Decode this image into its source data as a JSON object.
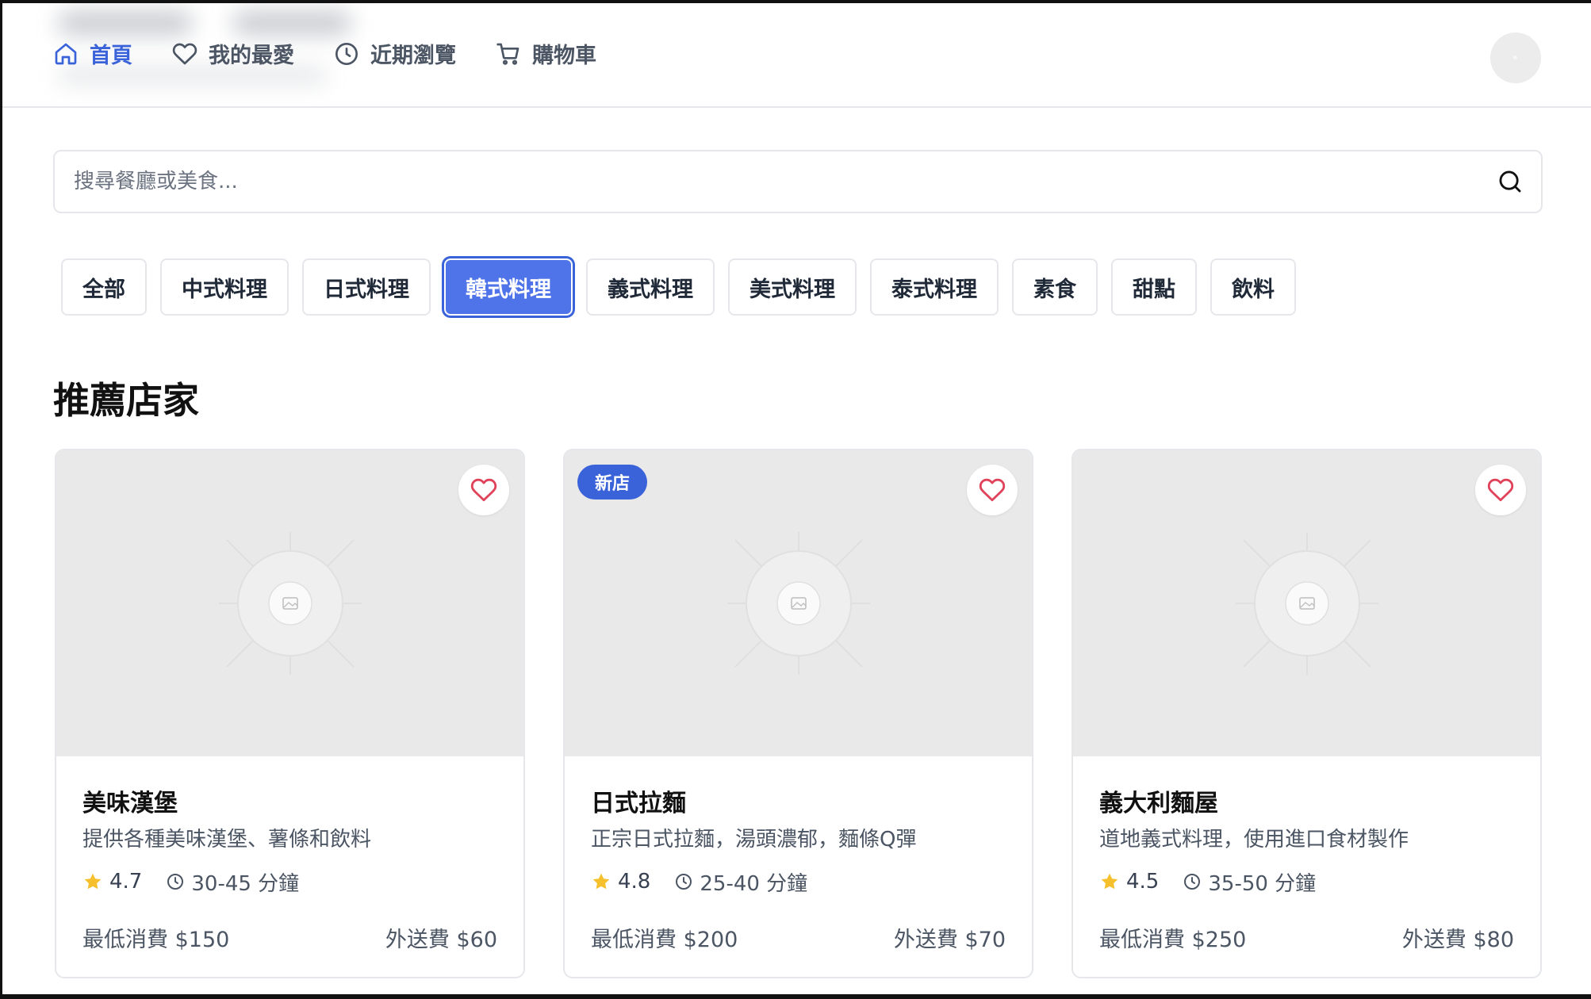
{
  "nav": {
    "items": [
      {
        "label": "首頁",
        "icon": "home-icon",
        "active": true
      },
      {
        "label": "我的最愛",
        "icon": "heart-icon",
        "active": false
      },
      {
        "label": "近期瀏覽",
        "icon": "clock-icon",
        "active": false
      },
      {
        "label": "購物車",
        "icon": "cart-icon",
        "active": false
      }
    ]
  },
  "search": {
    "placeholder": "搜尋餐廳或美食...",
    "value": ""
  },
  "categories": [
    {
      "label": "全部",
      "active": false
    },
    {
      "label": "中式料理",
      "active": false
    },
    {
      "label": "日式料理",
      "active": false
    },
    {
      "label": "韓式料理",
      "active": true
    },
    {
      "label": "義式料理",
      "active": false
    },
    {
      "label": "美式料理",
      "active": false
    },
    {
      "label": "泰式料理",
      "active": false
    },
    {
      "label": "素食",
      "active": false
    },
    {
      "label": "甜點",
      "active": false
    },
    {
      "label": "飲料",
      "active": false
    }
  ],
  "section": {
    "title": "推薦店家"
  },
  "restaurants": [
    {
      "name": "美味漢堡",
      "description": "提供各種美味漢堡、薯條和飲料",
      "rating": "4.7",
      "time": "30-45 分鐘",
      "min_order": "最低消費 $150",
      "delivery_fee": "外送費 $60",
      "badge": ""
    },
    {
      "name": "日式拉麵",
      "description": "正宗日式拉麵，湯頭濃郁，麵條Q彈",
      "rating": "4.8",
      "time": "25-40 分鐘",
      "min_order": "最低消費 $200",
      "delivery_fee": "外送費 $70",
      "badge": "新店"
    },
    {
      "name": "義大利麵屋",
      "description": "道地義式料理，使用進口食材製作",
      "rating": "4.5",
      "time": "35-50 分鐘",
      "min_order": "最低消費 $250",
      "delivery_fee": "外送費 $80",
      "badge": ""
    }
  ],
  "colors": {
    "accent": "#3b63d9",
    "active_category_bg": "#4f73e8",
    "favorite_heart": "#e0425a",
    "star": "#f5c02b",
    "image_placeholder": "#e9e9e9"
  }
}
